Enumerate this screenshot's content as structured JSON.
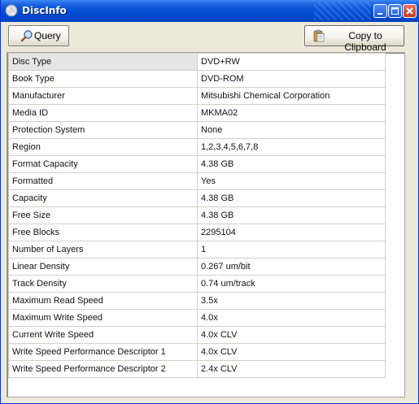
{
  "window": {
    "title": "DiscInfo"
  },
  "toolbar": {
    "query_label": "Query",
    "clipboard_label": "Copy to Clipboard"
  },
  "info_table": {
    "rows": [
      {
        "label": "Disc Type",
        "value": "DVD+RW"
      },
      {
        "label": "Book Type",
        "value": "DVD-ROM"
      },
      {
        "label": "Manufacturer",
        "value": "Mitsubishi Chemical Corporation"
      },
      {
        "label": "Media ID",
        "value": "MKMA02"
      },
      {
        "label": "Protection System",
        "value": "None"
      },
      {
        "label": "Region",
        "value": "1,2,3,4,5,6,7,8"
      },
      {
        "label": "Format Capacity",
        "value": "4.38 GB"
      },
      {
        "label": "Formatted",
        "value": "Yes"
      },
      {
        "label": "Capacity",
        "value": "4.38 GB"
      },
      {
        "label": "Free Size",
        "value": "4.38 GB"
      },
      {
        "label": "Free Blocks",
        "value": "2295104"
      },
      {
        "label": "Number of Layers",
        "value": "1"
      },
      {
        "label": "Linear Density",
        "value": "0.267 um/bit"
      },
      {
        "label": "Track Density",
        "value": "0.74 um/track"
      },
      {
        "label": "Maximum Read Speed",
        "value": "3.5x"
      },
      {
        "label": "Maximum Write Speed",
        "value": "4.0x"
      },
      {
        "label": "Current Write Speed",
        "value": "4.0x CLV"
      },
      {
        "label": "Write Speed Performance Descriptor 1",
        "value": "4.0x CLV"
      },
      {
        "label": "Write Speed Performance Descriptor 2",
        "value": "2.4x CLV"
      }
    ]
  },
  "icons": {
    "app": "disc-icon",
    "query": "magnifier-icon",
    "clipboard": "clipboard-icon",
    "minimize": "minimize-icon",
    "maximize": "maximize-icon",
    "close": "close-icon"
  },
  "colors": {
    "titlebar": "#0149cf",
    "window_bg": "#ece9d8",
    "grid_line": "#d4d0c8",
    "selected_cell": "#e6e6e6"
  }
}
